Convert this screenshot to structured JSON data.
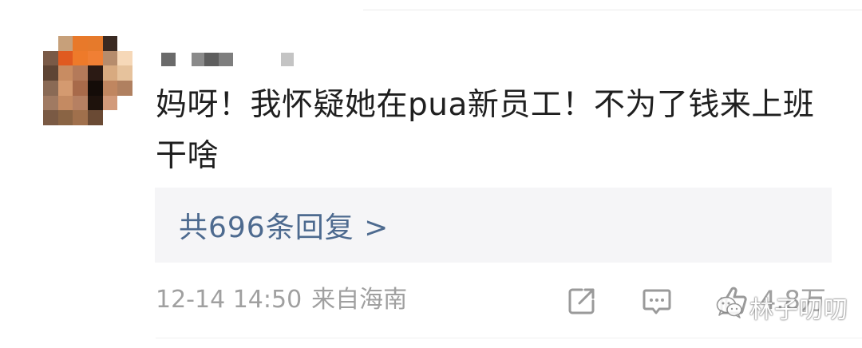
{
  "comment": {
    "avatar_alt": "avatar (pixelated)",
    "username_hidden": "",
    "text": "妈呀！我怀疑她在pua新员工！不为了钱来上班干啥",
    "replies_link": "共696条回复 >",
    "date": "12-14 14:50",
    "location": "来自海南",
    "like_count": "4.8万"
  },
  "icons": {
    "share": "share-icon",
    "comment": "comment-icon",
    "like": "thumbs-up-icon",
    "watermark": "wechat-icon"
  },
  "watermark": {
    "text": "林子叨叨"
  },
  "colors": {
    "text": "#1f1f1f",
    "link": "#4d6a8f",
    "meta": "#a0a0a0",
    "reply_bg": "#f5f5f7"
  }
}
